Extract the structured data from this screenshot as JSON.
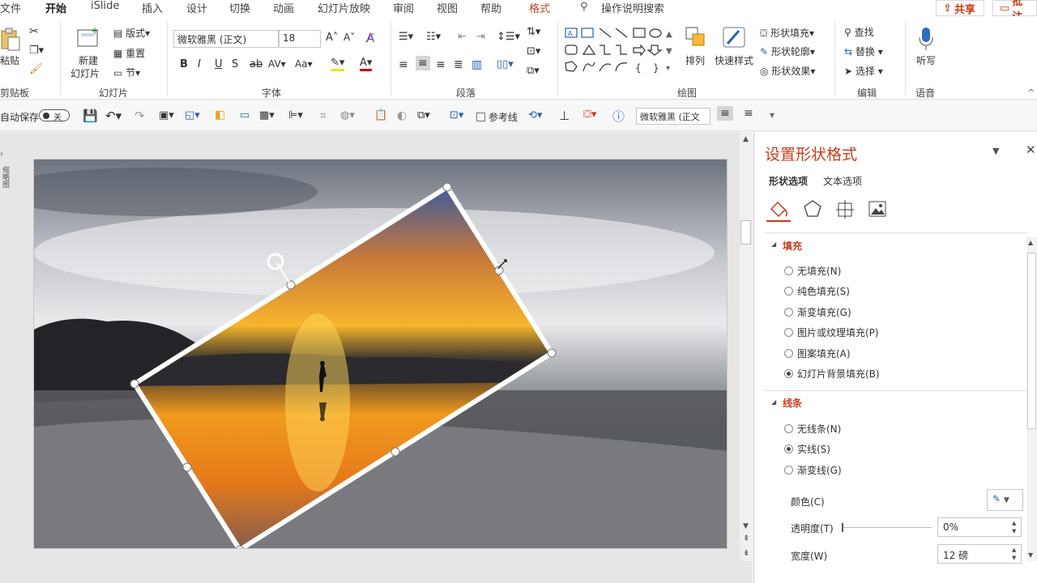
{
  "tabs": [
    "文件",
    "开始",
    "iSlide",
    "插入",
    "设计",
    "切换",
    "动画",
    "幻灯片放映",
    "审阅",
    "视图",
    "帮助",
    "格式"
  ],
  "tell_me": "操作说明搜索",
  "share_label": "共享",
  "comment_label": "批注",
  "ribbon": {
    "clipboard": {
      "paste": "粘贴",
      "label": "剪贴板"
    },
    "slides": {
      "new_slide": "新建",
      "new_slide2": "幻灯片",
      "layout": "版式",
      "reset": "重置",
      "section": "节",
      "label": "幻灯片"
    },
    "font": {
      "name": "微软雅黑 (正文)",
      "size": "18",
      "label": "字体"
    },
    "paragraph": {
      "label": "段落"
    },
    "drawing": {
      "arrange": "排列",
      "quick_styles": "快速样式",
      "shape_fill": "形状填充",
      "shape_outline": "形状轮廓",
      "shape_effects": "形状效果",
      "label": "绘图"
    },
    "editing": {
      "find": "查找",
      "replace": "替换",
      "select": "选择",
      "label": "编辑"
    },
    "voice": {
      "dictate": "听写",
      "label": "语音"
    }
  },
  "qat": {
    "autosave": "自动保存",
    "autosave_state": "关",
    "guides": "参考线",
    "font": "微软雅黑 (正文"
  },
  "pane": {
    "title": "设置形状格式",
    "tab_shape": "形状选项",
    "tab_text": "文本选项",
    "fill_header": "填充",
    "fill_options": [
      "无填充(N)",
      "纯色填充(S)",
      "渐变填充(G)",
      "图片或纹理填充(P)",
      "图案填充(A)",
      "幻灯片背景填充(B)"
    ],
    "fill_selected": 5,
    "line_header": "线条",
    "line_options": [
      "无线条(N)",
      "实线(S)",
      "渐变线(G)"
    ],
    "line_selected": 1,
    "color_label": "颜色(C)",
    "transparency_label": "透明度(T)",
    "transparency_value": "0%",
    "width_label": "宽度(W)",
    "width_value": "12 磅"
  },
  "colors": {
    "accent": "#c43e1c",
    "ribbon_bg": "#ffffff"
  }
}
